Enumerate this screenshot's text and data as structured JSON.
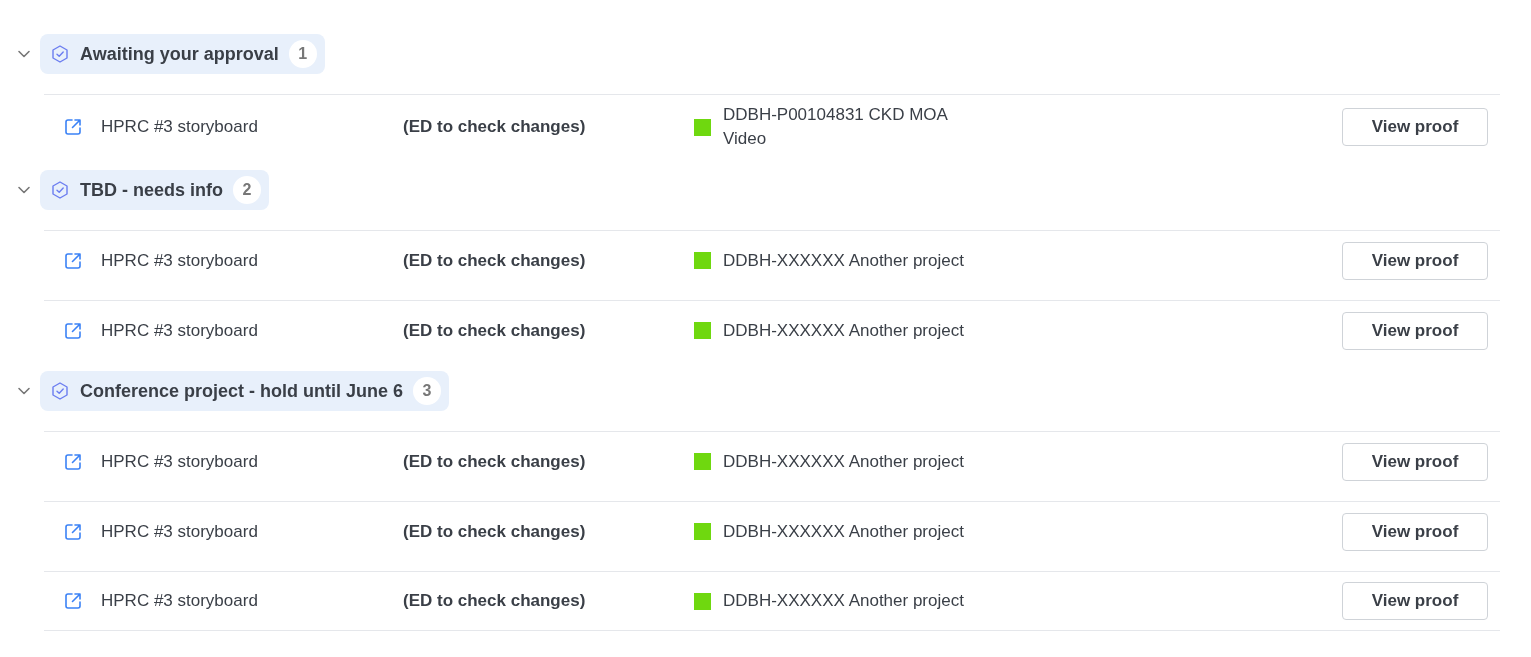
{
  "groups": [
    {
      "title": "Awaiting your approval",
      "count": "1",
      "expanded": true,
      "rows": [
        {
          "name": "HPRC #3 storyboard",
          "status": "(ED to check changes)",
          "project": "DDBH-P00104831 CKD MOA Video",
          "color": "#6fd80f",
          "action": "View proof"
        }
      ]
    },
    {
      "title": "TBD - needs info",
      "count": "2",
      "expanded": true,
      "rows": [
        {
          "name": "HPRC #3 storyboard",
          "status": "(ED to check changes)",
          "project": "DDBH-XXXXXX Another project",
          "color": "#6fd80f",
          "action": "View proof"
        },
        {
          "name": "HPRC #3 storyboard",
          "status": "(ED to check changes)",
          "project": "DDBH-XXXXXX Another project",
          "color": "#6fd80f",
          "action": "View proof"
        }
      ]
    },
    {
      "title": "Conference project - hold until June 6",
      "count": "3",
      "expanded": true,
      "rows": [
        {
          "name": "HPRC #3 storyboard",
          "status": "(ED to check changes)",
          "project": "DDBH-XXXXXX Another project",
          "color": "#6fd80f",
          "action": "View proof"
        },
        {
          "name": "HPRC #3 storyboard",
          "status": "(ED to check changes)",
          "project": "DDBH-XXXXXX Another project",
          "color": "#6fd80f",
          "action": "View proof"
        },
        {
          "name": "HPRC #3 storyboard",
          "status": "(ED to check changes)",
          "project": "DDBH-XXXXXX Another project",
          "color": "#6fd80f",
          "action": "View proof"
        }
      ]
    }
  ]
}
